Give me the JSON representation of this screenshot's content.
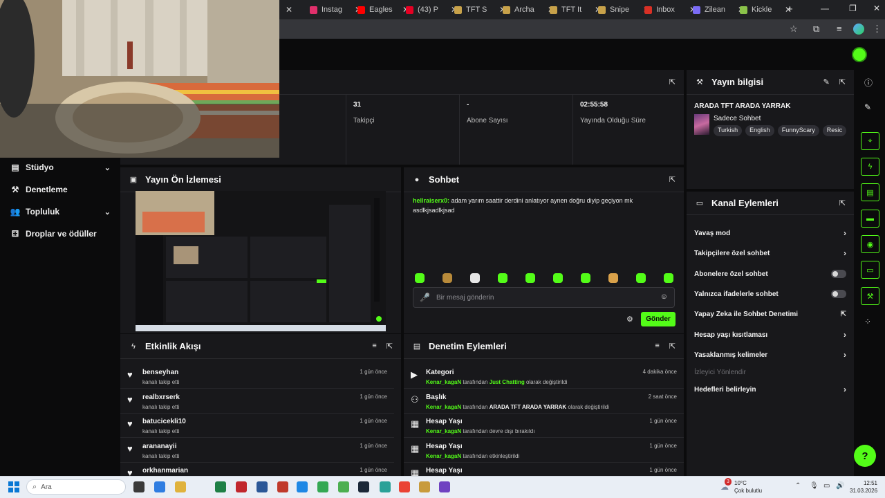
{
  "browser": {
    "tabs": [
      {
        "title": "",
        "color": "#e6e6e6"
      },
      {
        "title": "Instag",
        "color": "#e1306c"
      },
      {
        "title": "Eagles",
        "color": "#ff0000"
      },
      {
        "title": "(43) P",
        "color": "#e60023"
      },
      {
        "title": "TFT S",
        "color": "#c8a24a"
      },
      {
        "title": "Archa",
        "color": "#c8a24a"
      },
      {
        "title": "TFT It",
        "color": "#c8a24a"
      },
      {
        "title": "Snipe",
        "color": "#c8a24a"
      },
      {
        "title": "Inbox",
        "color": "#d93025"
      },
      {
        "title": "Zilean",
        "color": "#7b6cf6"
      },
      {
        "title": "Kickle",
        "color": "#8bc34a"
      }
    ],
    "new_tab": "+",
    "win_min": "—",
    "win_max": "❐",
    "win_close": "✕"
  },
  "sidebar": {
    "items": [
      {
        "label": "Stüdyo",
        "icon": "▤",
        "chevron": "⌄"
      },
      {
        "label": "Denetleme",
        "icon": "⚒",
        "chevron": ""
      },
      {
        "label": "Topluluk",
        "icon": "👥",
        "chevron": "⌄"
      },
      {
        "label": "Droplar ve ödüller",
        "icon": "⚃",
        "chevron": ""
      }
    ]
  },
  "stats": [
    {
      "value": "31",
      "label": "Takipçi"
    },
    {
      "value": "-",
      "label": "Abone Sayısı"
    },
    {
      "value": "02:55:58",
      "label": "Yayında Olduğu Süre"
    }
  ],
  "stream_info": {
    "title": "Yayın bilgisi",
    "stream_title": "ARADA TFT ARADA YARRAK",
    "category": "Sadece Sohbet",
    "tags": [
      "Turkish",
      "English",
      "FunnyScary",
      "Resic"
    ]
  },
  "preview": {
    "title": "Yayın Ön İzlemesi"
  },
  "chat": {
    "title": "Sohbet",
    "messages": [
      {
        "user": "hellraiserx0:",
        "text": " adam yarım saattir derdini anlatıyor aynen doğru diyip geçiyon mk asdlkjsadlkjsad"
      }
    ],
    "placeholder": "Bir mesaj gönderin",
    "send": "Gönder",
    "emote_colors": [
      "#53fc18",
      "#b88a3a",
      "#e6e6e6",
      "#53fc18",
      "#53fc18",
      "#53fc18",
      "#53fc18",
      "#d9a14a",
      "#53fc18",
      "#53fc18"
    ]
  },
  "activity": {
    "title": "Etkinlik Akışı",
    "items": [
      {
        "name": "benseyhan",
        "sub": "kanalı takip etti",
        "time": "1 gün önce"
      },
      {
        "name": "realbxrserk",
        "sub": "kanalı takip etti",
        "time": "1 gün önce"
      },
      {
        "name": "batucicekli10",
        "sub": "kanalı takip etti",
        "time": "1 gün önce"
      },
      {
        "name": "arananayii",
        "sub": "kanalı takip etti",
        "time": "1 gün önce"
      },
      {
        "name": "orkhanmarian",
        "sub": "",
        "time": "1 gün önce"
      }
    ]
  },
  "modlog": {
    "title": "Denetim Eylemleri",
    "items": [
      {
        "name": "Kategori",
        "icon": "▶",
        "actor": "Kenar_kagaN",
        "mid": " tarafından ",
        "obj": "Just Chatting",
        "obj_green": true,
        "tail": " olarak değiştirildi",
        "time": "4 dakika önce"
      },
      {
        "name": "Başlık",
        "icon": "⚇",
        "actor": "Kenar_kagaN",
        "mid": " tarafından ",
        "obj": "ARADA TFT ARADA YARRAK",
        "obj_green": false,
        "tail": " olarak değiştirildi",
        "time": "2 saat önce"
      },
      {
        "name": "Hesap Yaşı",
        "icon": "▦",
        "actor": "Kenar_kagaN",
        "mid": " tarafından devre dışı bırakıldı",
        "obj": "",
        "obj_green": false,
        "tail": "",
        "time": "1 gün önce"
      },
      {
        "name": "Hesap Yaşı",
        "icon": "▦",
        "actor": "Kenar_kagaN",
        "mid": " tarafından etkinleştirildi",
        "obj": "",
        "obj_green": false,
        "tail": "",
        "time": "1 gün önce"
      },
      {
        "name": "Hesap Yaşı",
        "icon": "▦",
        "actor": "",
        "mid": "",
        "obj": "",
        "obj_green": false,
        "tail": "",
        "time": "1 gün önce"
      }
    ]
  },
  "channel_actions": {
    "title": "Kanal Eylemleri",
    "items": [
      {
        "label": "Yavaş mod",
        "control": "chevron",
        "glyph": "›"
      },
      {
        "label": "Takipçilere özel sohbet",
        "control": "chevron",
        "glyph": "›"
      },
      {
        "label": "Abonelere özel sohbet",
        "control": "toggle",
        "glyph": ""
      },
      {
        "label": "Yalnızca ifadelerle sohbet",
        "control": "toggle",
        "glyph": ""
      },
      {
        "label": "Yapay Zeka ile Sohbet Denetimi",
        "control": "external",
        "glyph": "⇱"
      },
      {
        "label": "Hesap yaşı kısıtlaması",
        "control": "chevron",
        "glyph": "›"
      },
      {
        "label": "Yasaklanmış kelimeler",
        "control": "chevron",
        "glyph": "›"
      },
      {
        "label": "İzleyici Yönlendir",
        "control": "disabled",
        "glyph": ""
      },
      {
        "label": "Hedefleri belirleyin",
        "control": "chevron",
        "glyph": "›"
      }
    ]
  },
  "taskbar": {
    "search_placeholder": "Ara",
    "weather_temp": "10°C",
    "weather_desc": "Çok bulutlu",
    "weather_badge": "3",
    "time": "12:51",
    "date": "31.03.2026",
    "app_colors": [
      "#3a3a3a",
      "#2f7de1",
      "#e0b23c",
      "#1e7f45",
      "#c1272d",
      "#2b5797",
      "#c0392b",
      "#1e88e5",
      "#34a853",
      "#4caf50",
      "#1b2838",
      "#2aa198",
      "#ea4335",
      "#c89b3c",
      "#6f42c1"
    ]
  }
}
